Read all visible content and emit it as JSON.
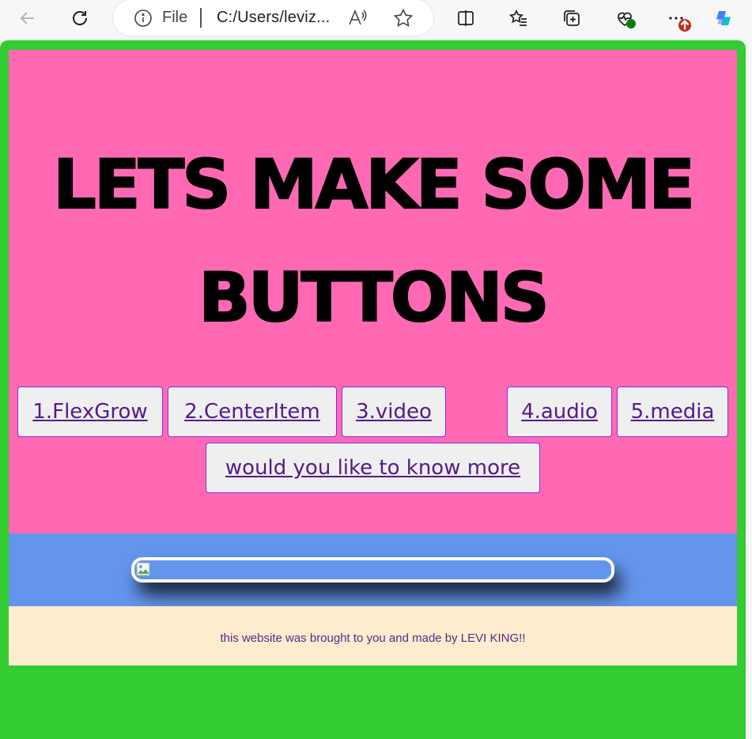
{
  "browser": {
    "address_scheme": "File",
    "address_url": "C:/Users/leviz...",
    "colors": {
      "badge_red": "#c42b1c",
      "badge_green": "#107c10"
    }
  },
  "page": {
    "title_line1": "LETS MAKE SOME",
    "title_line2": "BUTTONS",
    "buttons": [
      {
        "label": "1.FlexGrow"
      },
      {
        "label": "2.CenterItem"
      },
      {
        "label": "3.video"
      },
      {
        "label": "4.audio"
      },
      {
        "label": "5.media"
      },
      {
        "label": "would you like to know more"
      }
    ],
    "footer_text": "this website was brought to you and made by LEVI KING!!",
    "colors": {
      "frame": "#33cc33",
      "header": "#ff69b4",
      "bar": "#6495ed",
      "footer": "#ffebcd",
      "link": "#551a8b"
    }
  }
}
